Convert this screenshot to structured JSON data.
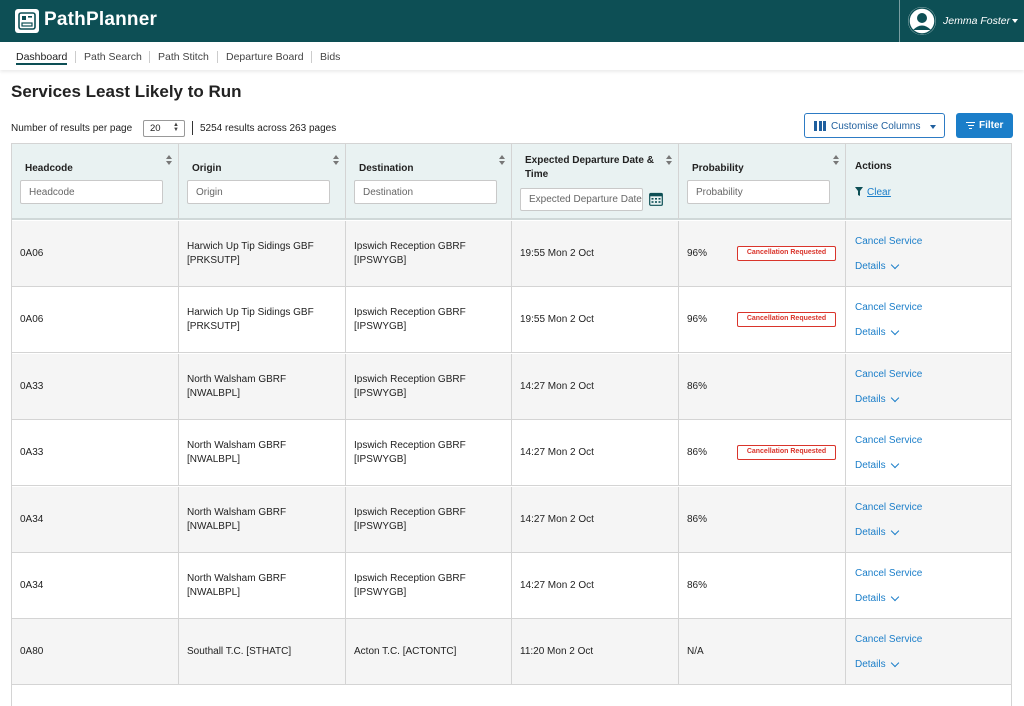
{
  "header": {
    "app_title": "PathPlanner",
    "user_name": "Jemma Foster"
  },
  "nav": {
    "items": [
      "Dashboard",
      "Path Search",
      "Path Stitch",
      "Departure Board",
      "Bids"
    ],
    "active": "Dashboard"
  },
  "page": {
    "title": "Services Least Likely to Run"
  },
  "controls": {
    "per_page_label": "Number of results per page",
    "per_page_value": "20",
    "results_text": "5254 results across 263 pages",
    "customise_label": "Customise Columns",
    "filter_label": "Filter"
  },
  "table": {
    "columns": [
      {
        "label": "Headcode",
        "placeholder": "Headcode"
      },
      {
        "label": "Origin",
        "placeholder": "Origin"
      },
      {
        "label": "Destination",
        "placeholder": "Destination"
      },
      {
        "label": "Expected Departure Date & Time",
        "placeholder": "Expected Departure Date & Time"
      },
      {
        "label": "Probability",
        "placeholder": "Probability"
      },
      {
        "label": "Actions",
        "clear_label": "Clear"
      }
    ],
    "cancel_label": "Cancel Service",
    "details_label": "Details",
    "rows": [
      {
        "headcode": "0A06",
        "origin": "Harwich Up Tip Sidings GBF [PRKSUTP]",
        "destination": "Ipswich Reception GBRF [IPSWYGB]",
        "departure": "19:55 Mon 2 Oct",
        "probability": "96%",
        "badge": "Cancellation Requested"
      },
      {
        "headcode": "0A06",
        "origin": "Harwich Up Tip Sidings GBF [PRKSUTP]",
        "destination": "Ipswich Reception GBRF [IPSWYGB]",
        "departure": "19:55 Mon 2 Oct",
        "probability": "96%",
        "badge": "Cancellation Requested"
      },
      {
        "headcode": "0A33",
        "origin": "North Walsham GBRF [NWALBPL]",
        "destination": "Ipswich Reception GBRF [IPSWYGB]",
        "departure": "14:27 Mon 2 Oct",
        "probability": "86%",
        "badge": ""
      },
      {
        "headcode": "0A33",
        "origin": "North Walsham GBRF [NWALBPL]",
        "destination": "Ipswich Reception GBRF [IPSWYGB]",
        "departure": "14:27 Mon 2 Oct",
        "probability": "86%",
        "badge": "Cancellation Requested"
      },
      {
        "headcode": "0A34",
        "origin": "North Walsham GBRF [NWALBPL]",
        "destination": "Ipswich Reception GBRF [IPSWYGB]",
        "departure": "14:27 Mon 2 Oct",
        "probability": "86%",
        "badge": ""
      },
      {
        "headcode": "0A34",
        "origin": "North Walsham GBRF [NWALBPL]",
        "destination": "Ipswich Reception GBRF [IPSWYGB]",
        "departure": "14:27 Mon 2 Oct",
        "probability": "86%",
        "badge": ""
      },
      {
        "headcode": "0A80",
        "origin": "Southall T.C. [STHATC]",
        "destination": "Acton T.C. [ACTONTC]",
        "departure": "11:20 Mon 2 Oct",
        "probability": "N/A",
        "badge": ""
      }
    ]
  },
  "colors": {
    "brand": "#0d4f55",
    "link": "#1b7ec9",
    "danger": "#d9342b",
    "header_bg": "#e9f2f2"
  }
}
